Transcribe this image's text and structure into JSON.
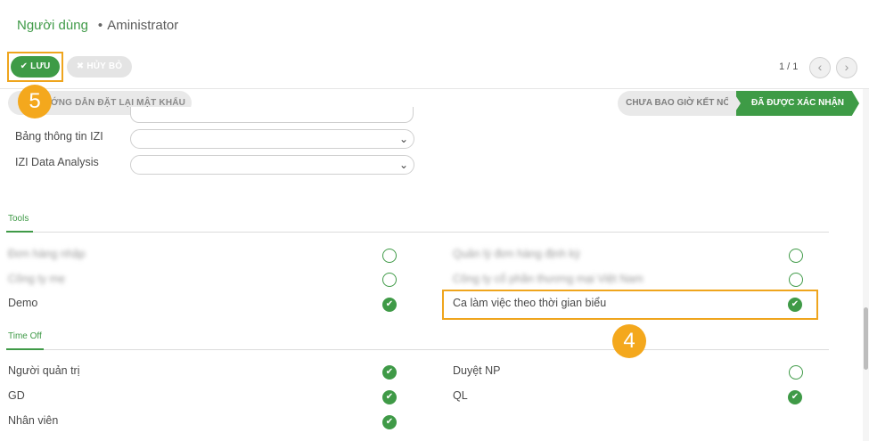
{
  "breadcrumb": {
    "parent": "Người dùng",
    "separator": "•",
    "current": "Aministrator"
  },
  "toolbar": {
    "save_label": "LƯU",
    "save_icon": "check-icon",
    "discard_label": "HỦY BỎ",
    "discard_icon": "close-icon"
  },
  "pager": {
    "value": "1 / 1",
    "prev": "‹",
    "next": "›"
  },
  "actions": {
    "reset_password_label": "ỚNG DẪN ĐẶT LẠI MẬT KHẨU"
  },
  "status": {
    "inactive": "CHƯA BAO GIỜ KẾT NỐI",
    "active": "ĐÃ ĐƯỢC XÁC NHẬN"
  },
  "fields": [
    {
      "label": "Bảng thông tin IZI",
      "value": ""
    },
    {
      "label": "IZI Data Analysis",
      "value": ""
    }
  ],
  "sections": {
    "tools": {
      "title": "Tools",
      "items": [
        {
          "label": "Đơn hàng nhập",
          "checked": false,
          "blurred": true
        },
        {
          "label": "Quản lý đơn hàng định kỳ",
          "checked": false,
          "blurred": true
        },
        {
          "label": "Công ty mẹ",
          "checked": false,
          "blurred": true
        },
        {
          "label": "Công ty cổ phần thương mại Việt Nam",
          "checked": false,
          "blurred": true
        },
        {
          "label": "Demo",
          "checked": true,
          "blurred": false
        },
        {
          "label": "Ca làm việc theo thời gian biểu",
          "checked": true,
          "blurred": false
        }
      ]
    },
    "time_off": {
      "title": "Time Off",
      "items": [
        {
          "label": "Người quản trị",
          "checked": true
        },
        {
          "label": "Duyệt NP",
          "checked": false
        },
        {
          "label": "GD",
          "checked": true
        },
        {
          "label": "QL",
          "checked": true
        },
        {
          "label": "Nhân viên",
          "checked": true
        }
      ]
    }
  },
  "annotations": {
    "step_4": "4",
    "step_5": "5"
  },
  "colors": {
    "accent": "#3f9a47",
    "highlight": "#efa51d",
    "callout": "#f4a81d"
  }
}
